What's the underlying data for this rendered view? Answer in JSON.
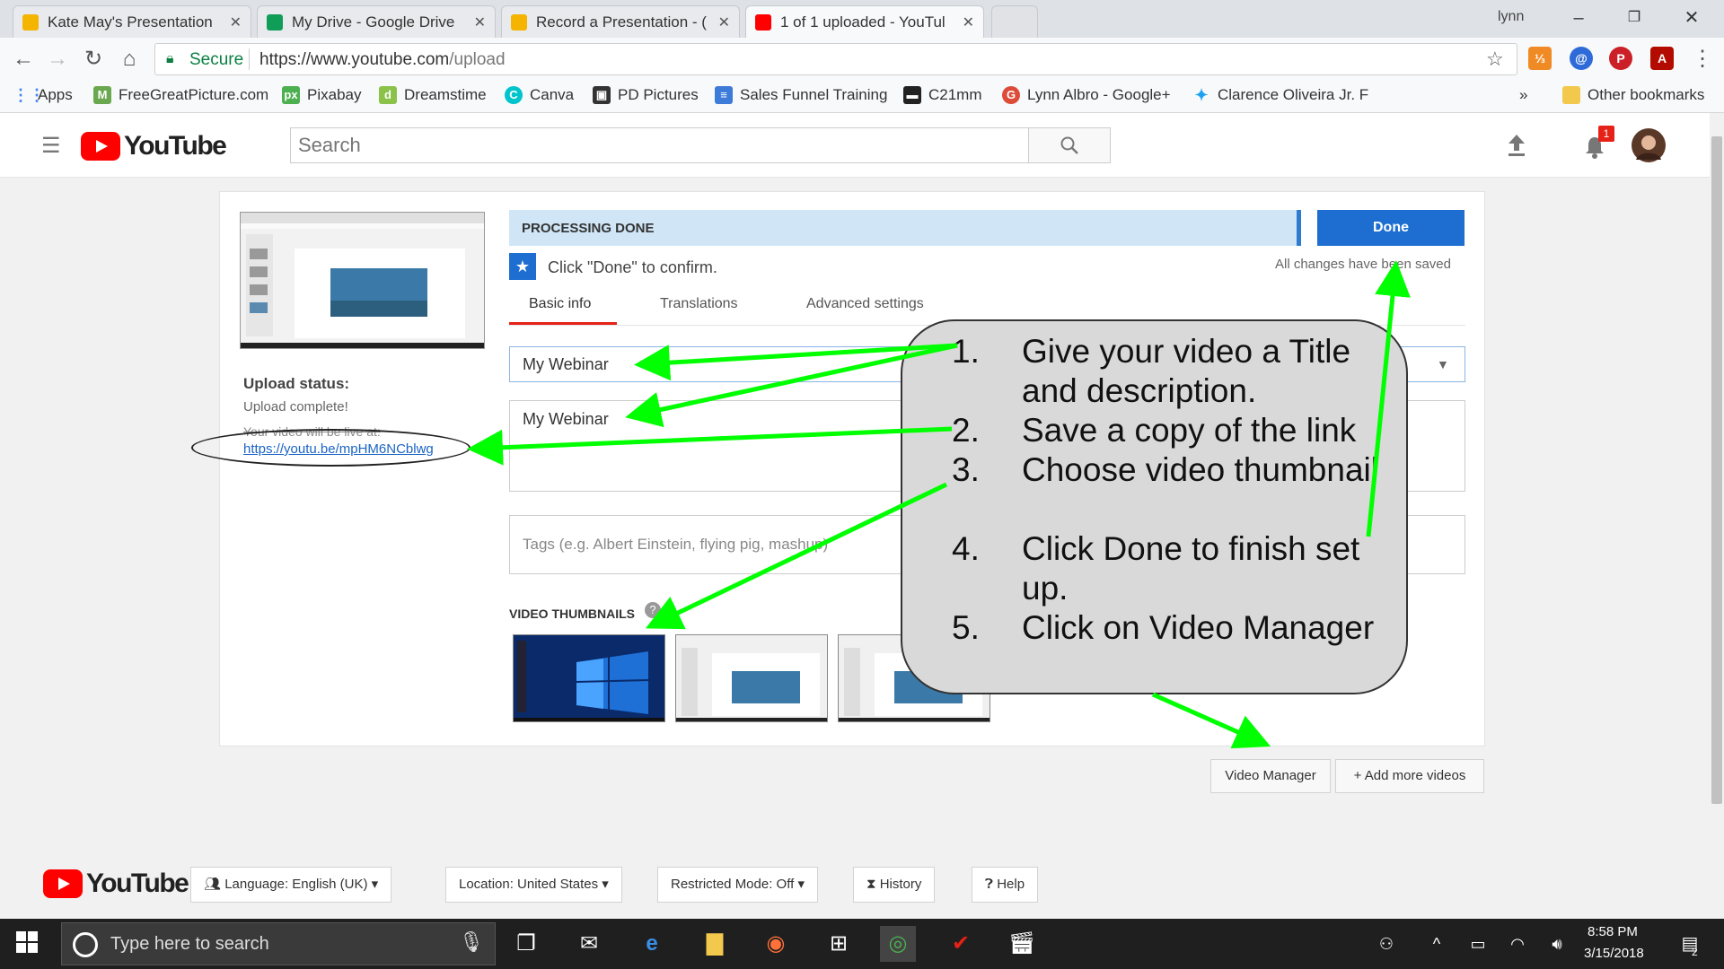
{
  "browser": {
    "tabs": [
      {
        "label": "Kate May's Presentation",
        "fav_color": "#f4b400"
      },
      {
        "label": "My Drive - Google Drive",
        "fav_color": "#0f9d58"
      },
      {
        "label": "Record a Presentation - (",
        "fav_color": "#f4b400"
      },
      {
        "label": "1 of 1 uploaded - YouTul",
        "fav_color": "#ff0000"
      }
    ],
    "tab_close": "✕",
    "user": "lynn",
    "secure_label": "Secure",
    "url_host": "https://www.youtube.com",
    "url_path": "/upload",
    "bookmarks": {
      "apps": "Apps",
      "items": [
        "FreeGreatPicture.com",
        "Pixabay",
        "Dreamstime",
        "Canva",
        "PD Pictures",
        "Sales Funnel Training",
        "C21mm",
        "Lynn Albro - Google+",
        "Clarence Oliveira Jr. F"
      ],
      "more": "»",
      "other": "Other bookmarks"
    }
  },
  "youtube": {
    "logo_word": "YouTube",
    "search_placeholder": "Search",
    "notification_count": "1"
  },
  "upload": {
    "status_title": "Upload status:",
    "status_value": "Upload complete!",
    "live_text": "Your video will be live at:",
    "video_link": "https://youtu.be/mpHM6NCblwg",
    "processing_label": "PROCESSING DONE",
    "done_label": "Done",
    "saved_text": "All changes have been saved",
    "confirm_text": "Click \"Done\" to confirm.",
    "tabs": [
      "Basic info",
      "Translations",
      "Advanced settings"
    ],
    "title_value": "My Webinar",
    "description_value": "My Webinar",
    "tags_placeholder": "Tags (e.g. Albert Einstein, flying pig, mashup)",
    "thumbnails_title": "VIDEO THUMBNAILS",
    "help_mark": "?",
    "video_manager_label": "Video Manager",
    "add_more_label": "Add more videos"
  },
  "callout": {
    "steps": [
      {
        "num": "1.",
        "text": "Give your video a Title and description."
      },
      {
        "num": "2.",
        "text": "Save a copy of the link"
      },
      {
        "num": "3.",
        "text": "Choose video thumbnail"
      },
      {
        "num": "4.",
        "text": "Click Done to finish set up."
      },
      {
        "num": "5.",
        "text": "Click on Video Manager"
      }
    ],
    "arrow_color": "#00ff00"
  },
  "footer": {
    "language": "Language: English (UK)",
    "location": "Location: United States",
    "restricted": "Restricted Mode: Off",
    "history": "History",
    "help": "Help"
  },
  "taskbar": {
    "search_placeholder": "Type here to search",
    "time": "8:58 PM",
    "date": "3/15/2018",
    "notif_count": "2"
  }
}
